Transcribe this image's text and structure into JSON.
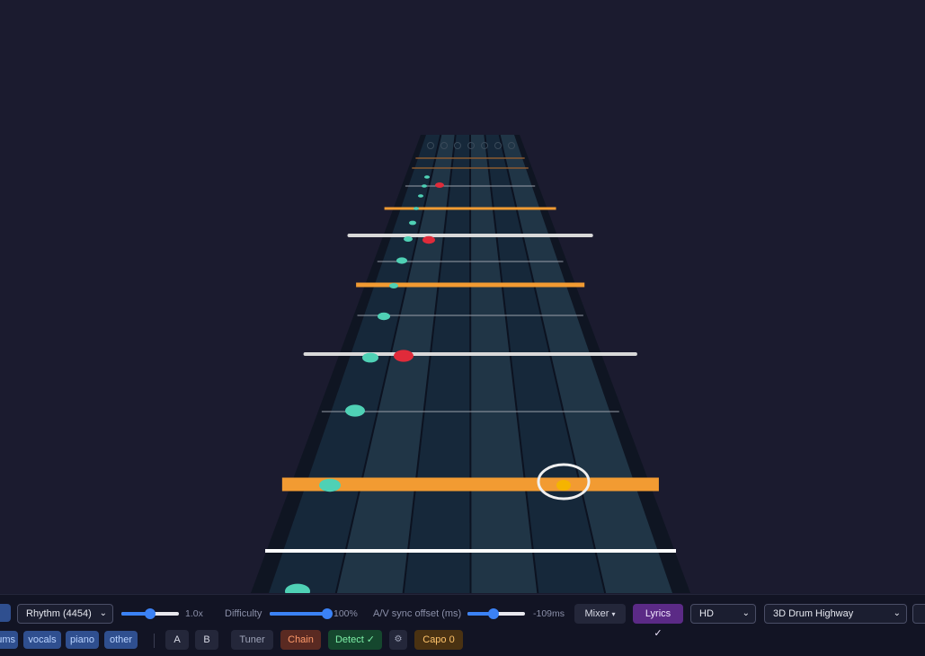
{
  "stems": [
    "ums",
    "vocals",
    "piano",
    "other"
  ],
  "arrangement_select": {
    "value": "Rhythm (4454)"
  },
  "speed": {
    "value": "1.0x",
    "fraction": 0.5
  },
  "difficulty": {
    "label": "Difficulty",
    "value": "100%",
    "fraction": 1.0
  },
  "av_sync": {
    "label": "A/V sync offset (ms)",
    "value": "-109ms",
    "fraction": 0.45
  },
  "mixer": {
    "label": "Mixer",
    "caret": "▾"
  },
  "lyrics": {
    "label": "Lyrics ✓"
  },
  "quality_select": {
    "value": "HD"
  },
  "renderer_select": {
    "value": "3D Drum Highway"
  },
  "loop": {
    "a": "A",
    "b": "B"
  },
  "tuner": {
    "label": "Tuner"
  },
  "chain": {
    "label": "Chain"
  },
  "detect": {
    "label": "Detect ✓"
  },
  "settings_glyph": "⚙",
  "capo": {
    "label": "Capo 0"
  },
  "colors": {
    "background": "#1b1b2f",
    "lane_dark": "#16283a",
    "lane_light": "#203546",
    "accent_orange": "#f29b32",
    "note_teal": "#4fd1b5",
    "note_red": "#e02b3a",
    "note_gold": "#f5b400",
    "slider_blue": "#3b82f6"
  }
}
